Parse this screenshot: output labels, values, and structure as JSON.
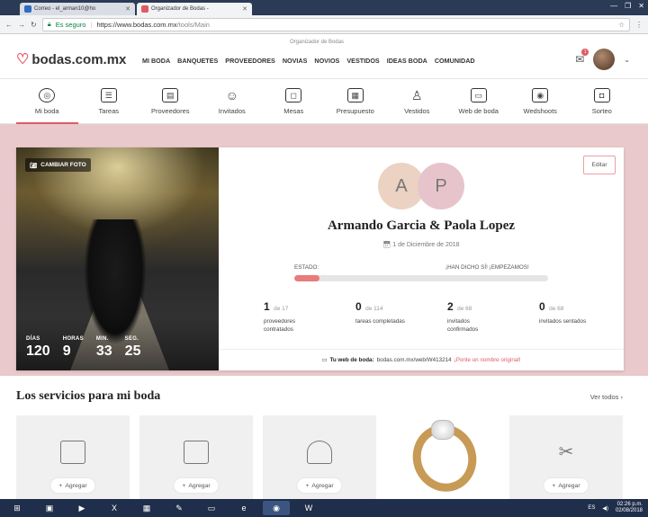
{
  "browser": {
    "tabs": [
      {
        "label": "Correo - el_arman10@ho",
        "favicon_color": "#2d6cc0",
        "active": false
      },
      {
        "label": "Organizador de Bodas - ",
        "favicon_color": "#e05a66",
        "active": true
      }
    ],
    "security_label": "Es seguro",
    "url_base": "https://www.bodas.com.mx",
    "url_path": "/tools/Main"
  },
  "header": {
    "logo_text": "bodas.com.mx",
    "tagline": "Organizador de Bodas",
    "nav": [
      "MI BODA",
      "BANQUETES",
      "PROVEEDORES",
      "NOVIAS",
      "NOVIOS",
      "VESTIDOS",
      "IDEAS BODA",
      "COMUNIDAD"
    ],
    "mail_badge": "1"
  },
  "tools": [
    {
      "label": "Mi boda",
      "icon": "rings-icon",
      "glyph": "◎",
      "active": true
    },
    {
      "label": "Tareas",
      "icon": "checklist-icon",
      "glyph": "☰",
      "active": false
    },
    {
      "label": "Proveedores",
      "icon": "book-icon",
      "glyph": "▤",
      "active": false
    },
    {
      "label": "Invitados",
      "icon": "guests-icon",
      "glyph": "☺",
      "active": false
    },
    {
      "label": "Mesas",
      "icon": "tables-icon",
      "glyph": "◻",
      "active": false
    },
    {
      "label": "Presupuesto",
      "icon": "calculator-icon",
      "glyph": "▦",
      "active": false
    },
    {
      "label": "Vestidos",
      "icon": "dress-icon",
      "glyph": "♙",
      "active": false
    },
    {
      "label": "Web de boda",
      "icon": "web-icon",
      "glyph": "▭",
      "active": false
    },
    {
      "label": "Wedshoots",
      "icon": "camera-icon",
      "glyph": "◉",
      "active": false
    },
    {
      "label": "Sorteo",
      "icon": "gift-card-icon",
      "glyph": "◘",
      "active": false
    }
  ],
  "hero": {
    "change_photo": "CAMBIAR FOTO",
    "countdown": [
      {
        "label": "DÍAS",
        "value": "120"
      },
      {
        "label": "HORAS",
        "value": "9"
      },
      {
        "label": "MIN.",
        "value": "33"
      },
      {
        "label": "SEG.",
        "value": "25"
      }
    ],
    "edit": "Editar",
    "initial_a": "A",
    "initial_p": "P",
    "couple_names": "Armando Garcia & Paola Lopez",
    "wedding_date": "1 de Diciembre de 2018",
    "estado_label": "ESTADO:",
    "status_text": "¡HAN DICHO SÍ! ¡EMPEZAMOS!",
    "progress_percent": 10,
    "stats": [
      {
        "num": "1",
        "of": "de 17",
        "label": "proveedores contratados"
      },
      {
        "num": "0",
        "of": "de 114",
        "label": "tareas completadas"
      },
      {
        "num": "2",
        "of": "de 68",
        "label": "invitados confirmados"
      },
      {
        "num": "0",
        "of": "de 68",
        "label": "invitados sentados"
      }
    ],
    "web_label": "Tu web de boda:",
    "web_url": "bodas.com.mx/web/W413214",
    "web_cta": "¡Ponle un nombre original!"
  },
  "services": {
    "title": "Los servicios para mi boda",
    "see_all": "Ver todos ›",
    "add_label": "Agregar",
    "items": [
      "invitations-icon",
      "gifts-icon",
      "person-icon",
      "ring-image",
      "tools-icon"
    ]
  },
  "taskbar": {
    "lang": "ES",
    "time": "02:26 p.m.",
    "date": "02/08/2018"
  }
}
